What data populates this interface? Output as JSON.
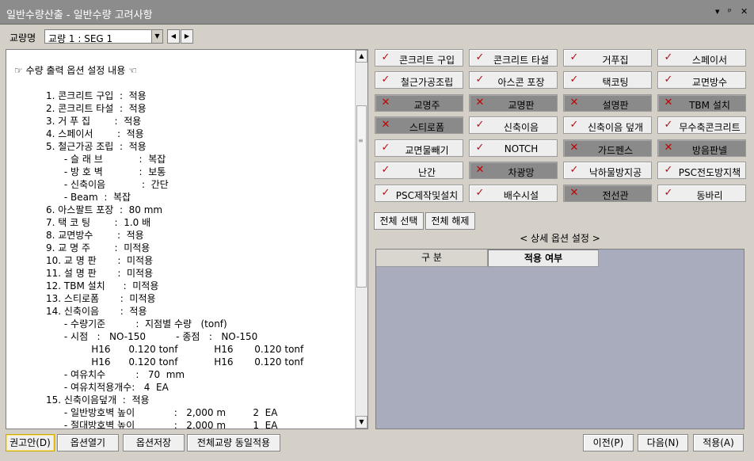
{
  "window": {
    "title": "일반수량산출 - 일반수량 고려사항",
    "pin_glyph": "▾ ᵖ ✕"
  },
  "toolbar": {
    "bridge_label": "교량명",
    "bridge_value": "교량 1 : SEG 1"
  },
  "report_lines": [
    "☞ 수량 출력 옵션 설정 내용 ☜",
    "",
    "1. 콘크리트 구입  :  적용",
    "2. 콘크리트 타설  :  적용",
    "3. 거 푸 집        :  적용",
    "4. 스페이서        :  적용",
    "5. 철근가공 조립  :  적용",
    "      - 슬 래 브            :  복잡",
    "      - 방 호 벽            :  보통",
    "      - 신축이음            :  간단",
    "      - Beam  :  복잡",
    "6. 아스팔트 포장  :  80 mm",
    "7. 택 코 팅        :  1.0 배",
    "8. 교면방수        :  적용",
    "9. 교 명 주        :  미적용",
    "10. 교 명 판       :  미적용",
    "11. 설 명 판       :  미적용",
    "12. TBM 설치      :  미적용",
    "13. 스티로폼       :  미적용",
    "14. 신축이음       :  적용",
    "      - 수량기준          :  지점별 수량   (tonf)",
    "      - 시점   :   NO-150          - 종점   :   NO-150",
    "               H16      0.120 tonf            H16       0.120 tonf",
    "               H16      0.120 tonf            H16       0.120 tonf",
    "      - 여유치수          :   70  mm",
    "      - 여유치적용개수:   4  EA",
    "15. 신축이음덮개  :  적용",
    "      - 일반방호벽 높이             :   2,000 m         2  EA",
    "      - 절대방호벽 높이             :   2,000 m         1  EA"
  ],
  "options": [
    {
      "label": "콘크리트 구입",
      "state": "on"
    },
    {
      "label": "콘크리트 타설",
      "state": "on"
    },
    {
      "label": "거푸집",
      "state": "on"
    },
    {
      "label": "스페이서",
      "state": "on"
    },
    {
      "label": "철근가공조립",
      "state": "on"
    },
    {
      "label": "아스콘 포장",
      "state": "on"
    },
    {
      "label": "택코팅",
      "state": "on"
    },
    {
      "label": "교면방수",
      "state": "on"
    },
    {
      "label": "교명주",
      "state": "off"
    },
    {
      "label": "교명판",
      "state": "off"
    },
    {
      "label": "설명판",
      "state": "off"
    },
    {
      "label": "TBM 설치",
      "state": "off"
    },
    {
      "label": "스티로폼",
      "state": "off"
    },
    {
      "label": "신축이음",
      "state": "on"
    },
    {
      "label": "신축이음 덮개",
      "state": "on"
    },
    {
      "label": "무수축콘크리트",
      "state": "on"
    },
    {
      "label": "교면물빼기",
      "state": "on"
    },
    {
      "label": "NOTCH",
      "state": "on"
    },
    {
      "label": "가드펜스",
      "state": "off"
    },
    {
      "label": "방음판넬",
      "state": "off"
    },
    {
      "label": "난간",
      "state": "on"
    },
    {
      "label": "차광망",
      "state": "off"
    },
    {
      "label": "낙하물방지공",
      "state": "on"
    },
    {
      "label": "PSC전도방지책",
      "state": "on"
    },
    {
      "label": "PSC제작및설치",
      "state": "on"
    },
    {
      "label": "배수시설",
      "state": "on"
    },
    {
      "label": "전선관",
      "state": "off"
    },
    {
      "label": "동바리",
      "state": "on"
    }
  ],
  "select_all_label": "전체 선택",
  "deselect_all_label": "전체 해제",
  "detail": {
    "title": "< 상세 옵션 설정 >",
    "col_category": "구 분",
    "col_apply": "적용 여부"
  },
  "bottom": {
    "recommend": "권고안(D)",
    "open_options": "옵션열기",
    "save_options": "옵션저장",
    "apply_all_bridges": "전체교량 동일적용",
    "prev": "이전(P)",
    "next": "다음(N)",
    "apply": "적용(A)"
  },
  "colors": {
    "check": "#b0101a",
    "cross": "#c00000",
    "button_on": "#eeeeee",
    "button_off": "#8a8a8a",
    "grid_bg": "#a8acbc"
  }
}
